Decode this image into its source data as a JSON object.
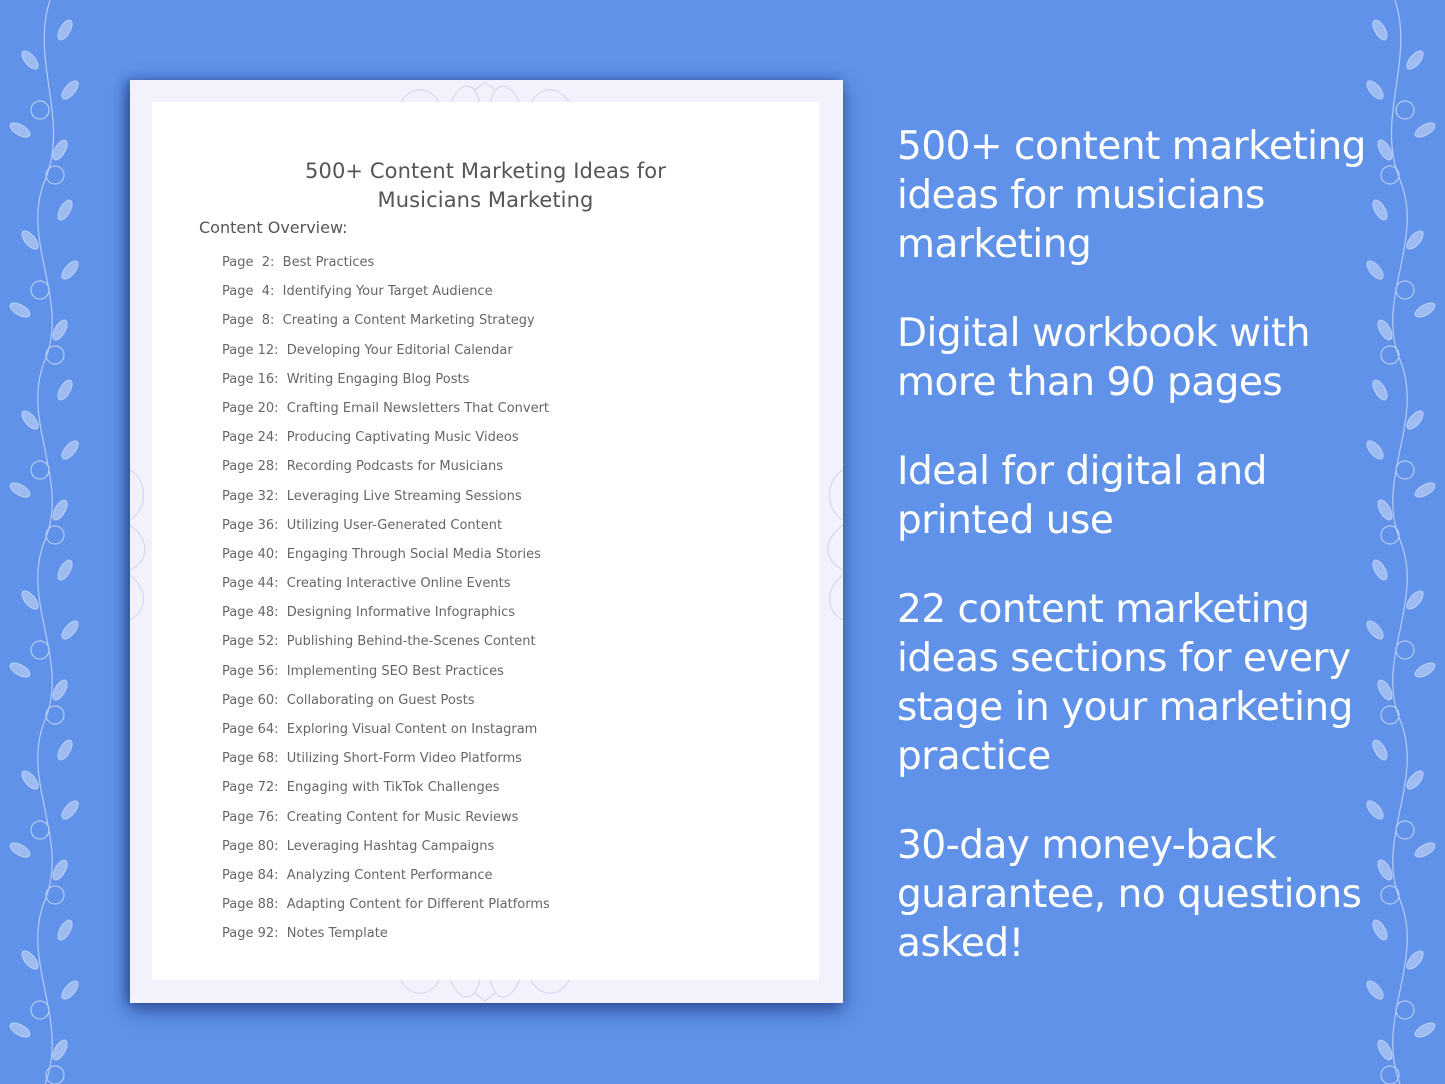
{
  "document": {
    "title_line1": "500+ Content Marketing Ideas for",
    "title_line2": "Musicians Marketing",
    "overview_label": "Content Overview:",
    "toc": [
      {
        "page": "Page  2:",
        "title": "Best Practices"
      },
      {
        "page": "Page  4:",
        "title": "Identifying Your Target Audience"
      },
      {
        "page": "Page  8:",
        "title": "Creating a Content Marketing Strategy"
      },
      {
        "page": "Page 12:",
        "title": "Developing Your Editorial Calendar"
      },
      {
        "page": "Page 16:",
        "title": "Writing Engaging Blog Posts"
      },
      {
        "page": "Page 20:",
        "title": "Crafting Email Newsletters That Convert"
      },
      {
        "page": "Page 24:",
        "title": "Producing Captivating Music Videos"
      },
      {
        "page": "Page 28:",
        "title": "Recording Podcasts for Musicians"
      },
      {
        "page": "Page 32:",
        "title": "Leveraging Live Streaming Sessions"
      },
      {
        "page": "Page 36:",
        "title": "Utilizing User-Generated Content"
      },
      {
        "page": "Page 40:",
        "title": "Engaging Through Social Media Stories"
      },
      {
        "page": "Page 44:",
        "title": "Creating Interactive Online Events"
      },
      {
        "page": "Page 48:",
        "title": "Designing Informative Infographics"
      },
      {
        "page": "Page 52:",
        "title": "Publishing Behind-the-Scenes Content"
      },
      {
        "page": "Page 56:",
        "title": "Implementing SEO Best Practices"
      },
      {
        "page": "Page 60:",
        "title": "Collaborating on Guest Posts"
      },
      {
        "page": "Page 64:",
        "title": "Exploring Visual Content on Instagram"
      },
      {
        "page": "Page 68:",
        "title": "Utilizing Short-Form Video Platforms"
      },
      {
        "page": "Page 72:",
        "title": "Engaging with TikTok Challenges"
      },
      {
        "page": "Page 76:",
        "title": "Creating Content for Music Reviews"
      },
      {
        "page": "Page 80:",
        "title": "Leveraging Hashtag Campaigns"
      },
      {
        "page": "Page 84:",
        "title": "Analyzing Content Performance"
      },
      {
        "page": "Page 88:",
        "title": "Adapting Content for Different Platforms"
      },
      {
        "page": "Page 92:",
        "title": "Notes Template"
      }
    ]
  },
  "features": [
    "500+ content marketing ideas for musicians marketing",
    "Digital workbook with more than 90 pages",
    "Ideal for digital and printed use",
    "22 content marketing ideas sections for every stage in your marketing practice",
    "30-day money-back guarantee, no questions asked!"
  ],
  "colors": {
    "background": "#5f92e8",
    "page_frame": "#f3f1fc",
    "page": "#ffffff",
    "text_dark": "#555555",
    "feature_text": "#ffffff"
  }
}
